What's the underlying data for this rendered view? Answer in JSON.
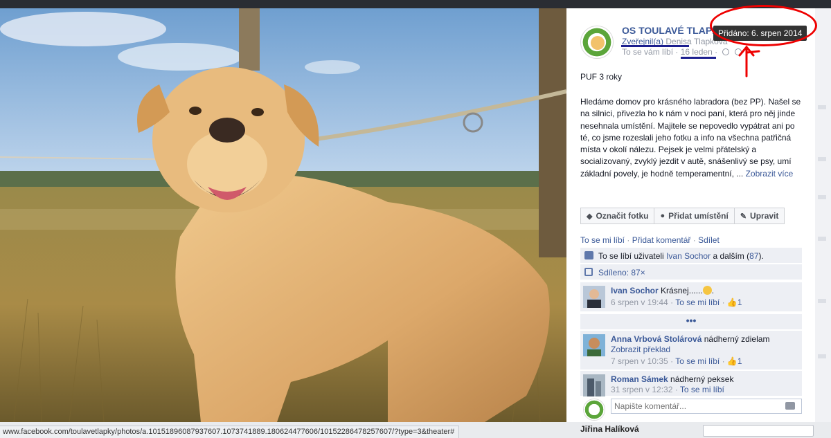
{
  "post": {
    "page_name": "OS TOULAVÉ TLAPK",
    "shared_prefix": "Zveřejnil(a)",
    "shared_by": "Denisa Tlapková",
    "meta_like": "To se vám líbí",
    "meta_date": "16 leden",
    "tooltip": "Přidáno: 6. srpen 2014",
    "title": "PUF 3 roky",
    "body": "Hledáme domov pro krásného labradora (bez PP). Našel se na silnici, přivezla ho k nám v noci paní, která pro něj jinde nesehnala umístění. Majitele se nepovedlo vypátrat ani po té, co jsme rozeslali jeho fotku a info na všechna patřičná místa v okolí nálezu. Pejsek je velmi přátelský a socializovaný, zvyklý jezdit v autě, snášenlivý se psy, umí základní povely, je hodně temperamentní, ...",
    "show_more": "Zobrazit více"
  },
  "buttons": {
    "tag": "Označit fotku",
    "location": "Přidat umístění",
    "edit": "Upravit"
  },
  "actions": {
    "like": "To se mi líbí",
    "comment": "Přidat komentář",
    "share": "Sdílet",
    "sep": "·"
  },
  "likes": {
    "prefix": "To se líbí uživateli",
    "user": "Ivan Sochor",
    "mid": "a dalším (",
    "count": "87",
    "suffix": ")."
  },
  "shares": {
    "label": "Sdíleno: 87×"
  },
  "comments": [
    {
      "author": "Ivan Sochor",
      "text": "Krásnej......",
      "date": "6 srpen v 19:44",
      "like": "To se mi líbí",
      "likes": "1",
      "translate": ""
    },
    {
      "author": "Anna Vrbová Stolárová",
      "text": "nádherný zdielam",
      "date": "7 srpen v 10:35",
      "like": "To se mi líbí",
      "likes": "1",
      "translate": "Zobrazit překlad"
    },
    {
      "author": "Roman Sámek",
      "text": "nádherný peksek",
      "date": "31 srpen v 12:32",
      "like": "To se mi líbí",
      "likes": "",
      "translate": ""
    }
  ],
  "more_comments": "•••",
  "compose": {
    "placeholder": "Napište komentář..."
  },
  "statusbar": {
    "url": "www.facebook.com/toulavetlapky/photos/a.10151896087937607.1073741889.180624477606/10152286478257607/?type=3&theater#"
  },
  "behind": {
    "name": "Jiřina Halíková"
  },
  "colors": {
    "fb_blue": "#3b5998",
    "annotation_red": "#e00000",
    "annotation_blue": "#1c1f8f"
  }
}
